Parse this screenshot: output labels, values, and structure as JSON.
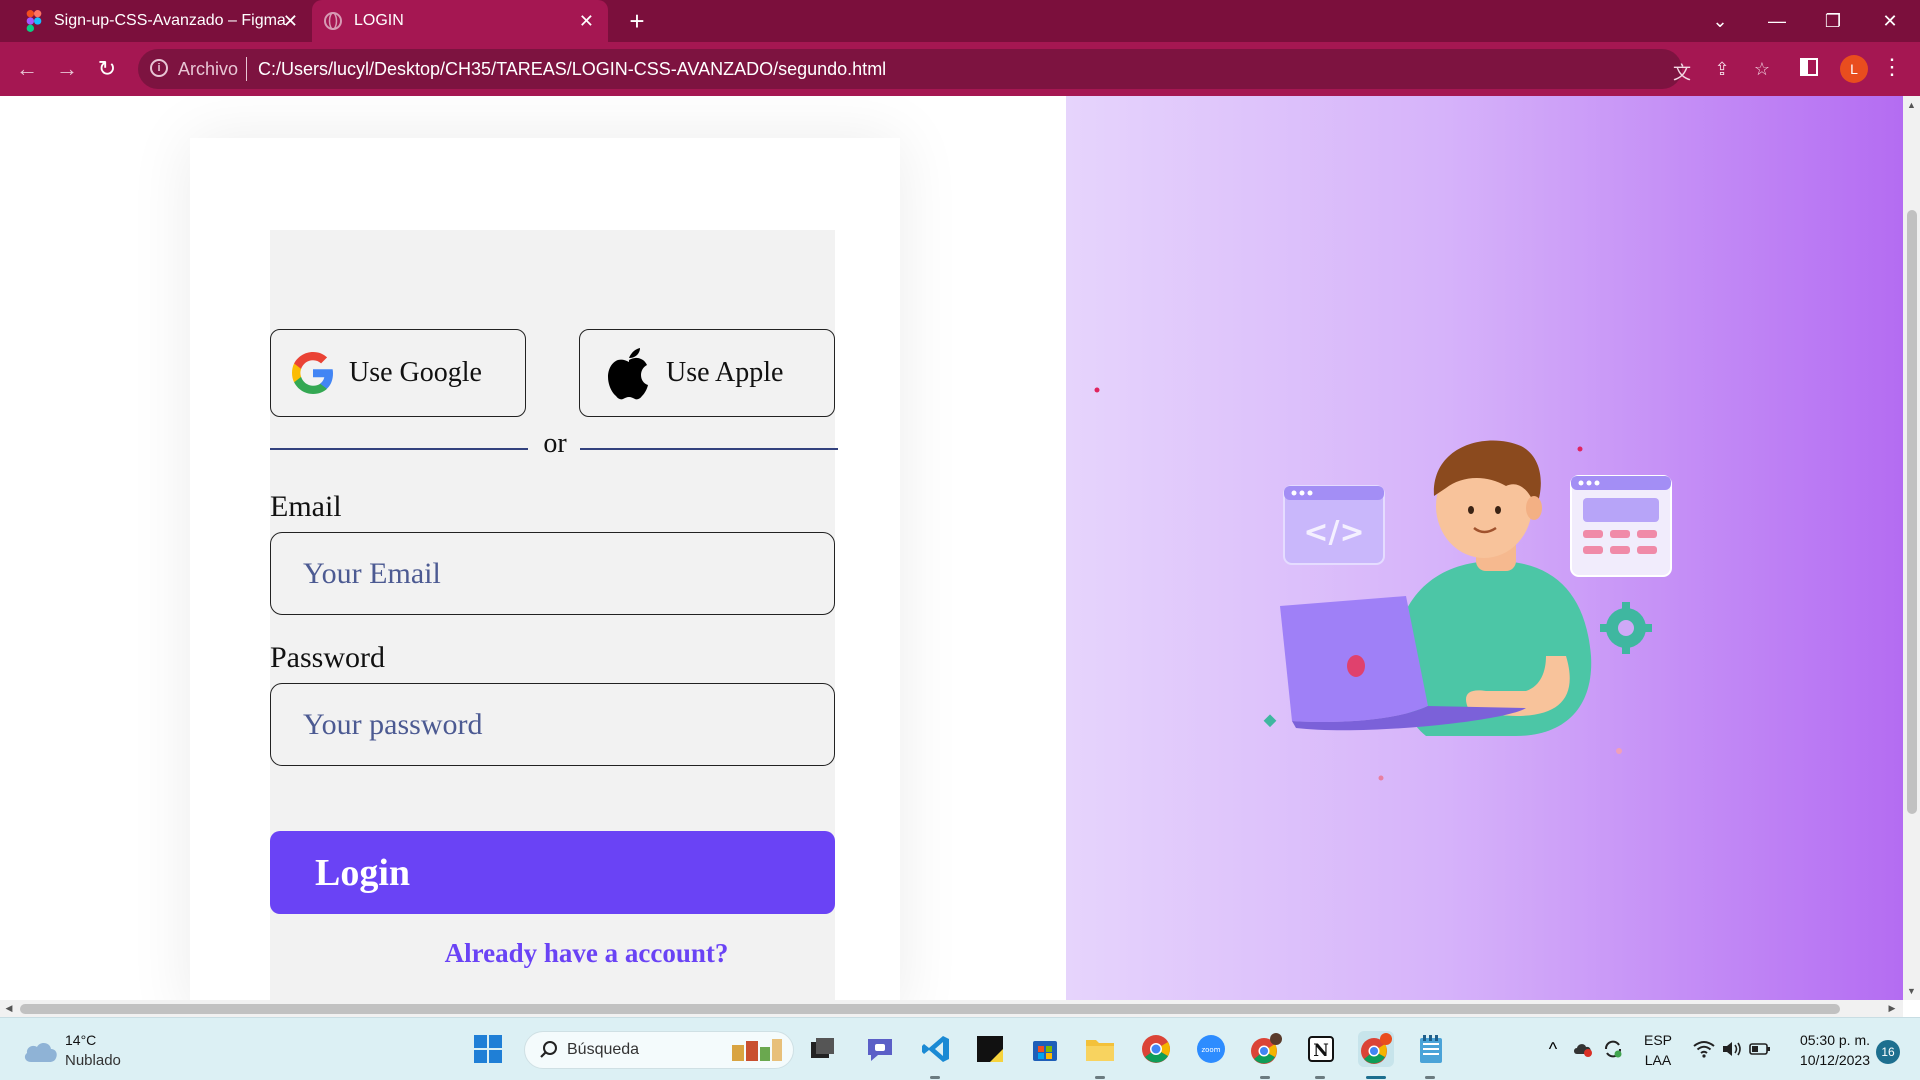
{
  "browser": {
    "tabs": [
      {
        "title": "Sign-up-CSS-Avanzado – Figma",
        "active": false
      },
      {
        "title": "LOGIN",
        "active": true
      }
    ],
    "address": {
      "scheme_label": "Archivo",
      "url": "C:/Users/lucyl/Desktop/CH35/TAREAS/LOGIN-CSS-AVANZADO/segundo.html"
    },
    "profile_initial": "L",
    "colors": {
      "tabbar": "#7b0f3c",
      "toolbar": "#a51752"
    }
  },
  "page": {
    "social": {
      "google_label": "Use Google",
      "apple_label": "Use Apple"
    },
    "divider_text": "or",
    "email": {
      "label": "Email",
      "placeholder": "Your Email"
    },
    "password": {
      "label": "Password",
      "placeholder": "Your password"
    },
    "login_button": "Login",
    "account_link": "Already have a account?",
    "colors": {
      "accent": "#6a43f5",
      "placeholder": "#4c5a92",
      "panel_gradient": [
        "#e6d4fc",
        "#b46cf2"
      ]
    }
  },
  "taskbar": {
    "weather": {
      "temp": "14°C",
      "desc": "Nublado"
    },
    "search_placeholder": "Búsqueda",
    "lang": {
      "top": "ESP",
      "bottom": "LAA"
    },
    "time": "05:30 p. m.",
    "date": "10/12/2023",
    "notifications": "16"
  }
}
